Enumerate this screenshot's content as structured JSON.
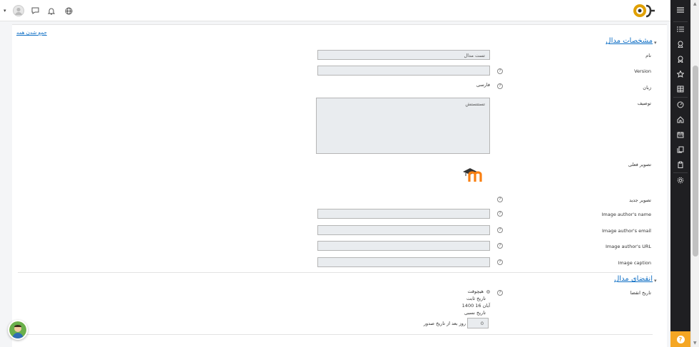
{
  "topbar": {
    "icons": [
      "user-menu-caret",
      "avatar",
      "messages-icon",
      "notifications-icon",
      "language-icon"
    ]
  },
  "main": {
    "collapse_all": "جمع شدن همه",
    "section_general": "مشخصات مدال",
    "section_expiry": "انقضای مدال",
    "fields": {
      "name_label": "نام",
      "name_value": "تست مدال",
      "version_label": "Version",
      "version_value": "",
      "language_label": "زبان",
      "language_value": "فارسی",
      "description_label": "توصیف",
      "description_value": "تستتستش",
      "current_image_label": "تصویر فعلی",
      "new_image_label": "تصویر جدید",
      "image_author_name_label": "Image author's name",
      "image_author_email_label": "Image author's email",
      "image_author_url_label": "Image author's URL",
      "image_caption_label": "Image caption",
      "expiry_label": "تاریخ انقضا",
      "expiry_never": "هیچوقت",
      "expiry_fixed": "تاریخ ثابت",
      "expiry_fixed_value": "1400  آبان  16",
      "expiry_relative": "تاریخ نسبی",
      "expiry_days_value": "0",
      "expiry_days_suffix": "روز  بعد از تاریخ صدور"
    },
    "help_icon": "?"
  },
  "colors": {
    "accent": "#0f6fc5",
    "rail": "#1f1f22",
    "help": "#f5a623",
    "moodle_orange": "#f98012"
  }
}
